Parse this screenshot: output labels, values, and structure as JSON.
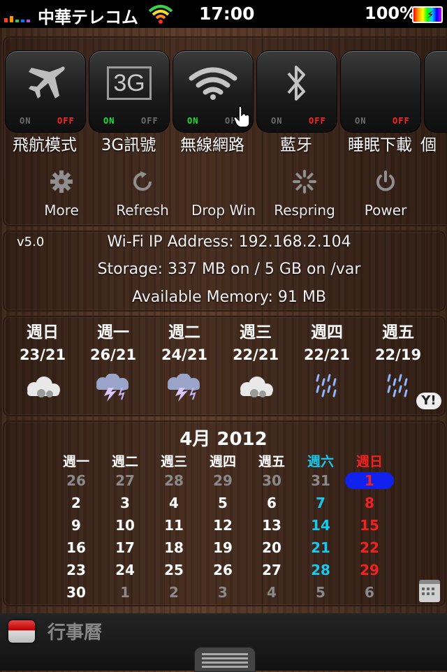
{
  "status_bar": {
    "carrier": "中華テレコム",
    "time": "17:00",
    "battery": "100%",
    "signal_colors": [
      "#ff3b30",
      "#ff9500",
      "#34c759",
      "#007aff",
      "#af52de"
    ]
  },
  "toggles": [
    {
      "label": "飛航模式",
      "icon": "airplane-icon",
      "on": "ON",
      "off": "OFF",
      "state": "off"
    },
    {
      "label": "3G訊號",
      "icon": "3g-icon",
      "icon_text": "3G",
      "on": "ON",
      "off": "OFF",
      "state": "on"
    },
    {
      "label": "無線網路",
      "icon": "wifi-icon",
      "on": "ON",
      "off": "OFF",
      "state": "on"
    },
    {
      "label": "藍牙",
      "icon": "bluetooth-icon",
      "on": "ON",
      "off": "OFF",
      "state": "off"
    },
    {
      "label": "睡眠下載",
      "icon": "sleep-download-icon",
      "on": "ON",
      "off": "OFF",
      "state": "off"
    },
    {
      "label": "個",
      "icon": "unknown-icon",
      "on": "",
      "off": "",
      "state": "off"
    }
  ],
  "actions": [
    {
      "label": "More",
      "icon": "gear-icon"
    },
    {
      "label": "Refresh",
      "icon": "refresh-icon"
    },
    {
      "label": "Drop Win",
      "icon": ""
    },
    {
      "label": "Respring",
      "icon": "respring-icon"
    },
    {
      "label": "Power",
      "icon": "power-icon"
    }
  ],
  "info": {
    "version": "v5.0",
    "wifi_ip": "Wi-Fi IP Address: 192.168.2.104",
    "storage": "Storage: 337 MB on / 5 GB on /var",
    "memory": "Available Memory: 91 MB"
  },
  "weather": [
    {
      "day": "週日",
      "temps": "23/21",
      "icon": "cloudy-icon"
    },
    {
      "day": "週一",
      "temps": "26/21",
      "icon": "thunderstorm-icon"
    },
    {
      "day": "週二",
      "temps": "24/21",
      "icon": "thunderstorm-icon"
    },
    {
      "day": "週三",
      "temps": "22/21",
      "icon": "cloudy-icon"
    },
    {
      "day": "週四",
      "temps": "22/21",
      "icon": "rain-icon"
    },
    {
      "day": "週五",
      "temps": "22/19",
      "icon": "rain-icon"
    }
  ],
  "weather_source": "Y!",
  "calendar": {
    "title": "4月 2012",
    "headers": [
      "週一",
      "週二",
      "週三",
      "週四",
      "週五",
      "週六",
      "週日"
    ],
    "weeks": [
      [
        "26",
        "27",
        "28",
        "29",
        "30",
        "31",
        "1"
      ],
      [
        "2",
        "3",
        "4",
        "5",
        "6",
        "7",
        "8"
      ],
      [
        "9",
        "10",
        "11",
        "12",
        "13",
        "14",
        "15"
      ],
      [
        "16",
        "17",
        "18",
        "19",
        "20",
        "21",
        "22"
      ],
      [
        "23",
        "24",
        "25",
        "26",
        "27",
        "28",
        "29"
      ],
      [
        "30",
        "1",
        "2",
        "3",
        "4",
        "5",
        "6"
      ]
    ],
    "today": "1"
  },
  "bottom": {
    "label": "行事曆"
  }
}
